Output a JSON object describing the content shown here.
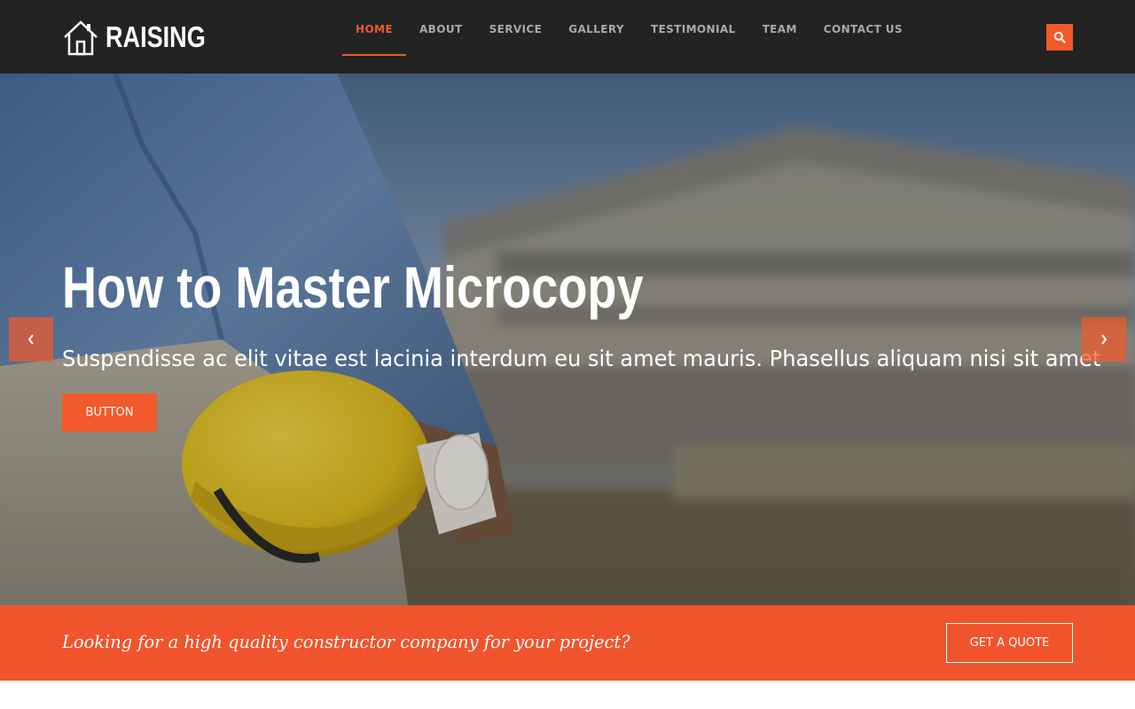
{
  "brand": {
    "name": "RAISING",
    "icon": "house-icon",
    "accent_color": "#f15a2b",
    "header_bg": "#232323"
  },
  "nav": {
    "items": [
      {
        "label": "HOME",
        "active": true
      },
      {
        "label": "ABOUT",
        "active": false
      },
      {
        "label": "SERVICE",
        "active": false
      },
      {
        "label": "GALLERY",
        "active": false
      },
      {
        "label": "TESTIMONIAL",
        "active": false
      },
      {
        "label": "TEAM",
        "active": false
      },
      {
        "label": "CONTACT US",
        "active": false
      }
    ],
    "search_icon": "search-icon"
  },
  "hero": {
    "title": "How to Master Microcopy",
    "subtitle": "Suspendisse ac elit vitae est lacinia interdum eu sit amet mauris. Phasellus aliquam nisi sit amet",
    "button_label": "BUTTON",
    "prev_icon": "chevron-left-icon",
    "next_icon": "chevron-right-icon"
  },
  "cta": {
    "text": "Looking for a high quality constructor company for your project?",
    "button_label": "GET A QUOTE",
    "bg_color": "#f1542c"
  }
}
